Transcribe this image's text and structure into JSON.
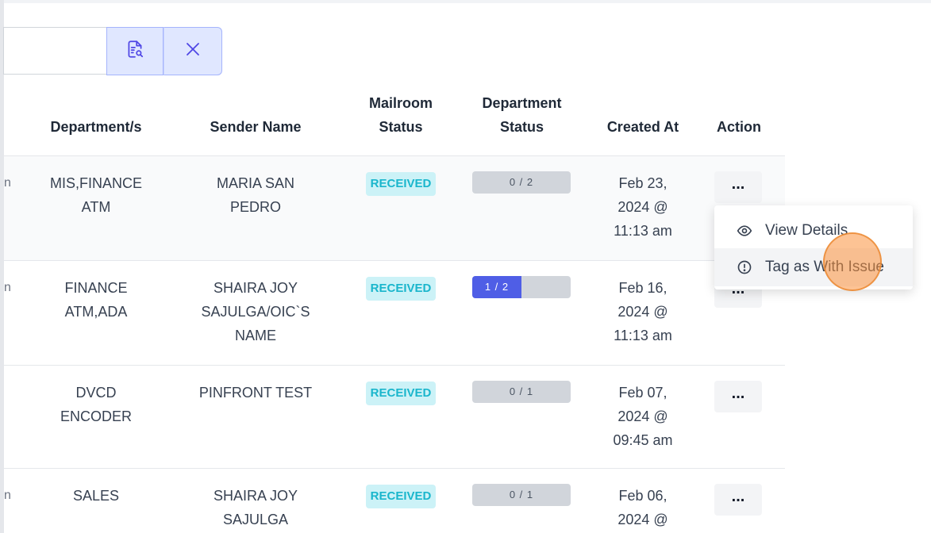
{
  "toolbar": {
    "search_placeholder": "",
    "search_icon": "document-search-icon",
    "clear_icon": "close-icon"
  },
  "table": {
    "headers": {
      "department": "Department/s",
      "sender": "Sender Name",
      "mailroom_1": "Mailroom",
      "mailroom_2": "Status",
      "dept_status_1": "Department",
      "dept_status_2": "Status",
      "created": "Created At",
      "action": "Action"
    },
    "rows": [
      {
        "edge": "n",
        "department": [
          "MIS,FINANCE",
          "ATM"
        ],
        "sender": [
          "MARIA SAN",
          "PEDRO"
        ],
        "mailroom_status": "RECEIVED",
        "dept_status": "0 / 2",
        "dept_progress": 0,
        "created": [
          "Feb 23,",
          "2024 @",
          "11:13 am"
        ],
        "action": "..."
      },
      {
        "edge": "n",
        "department": [
          "FINANCE",
          "ATM,ADA"
        ],
        "sender": [
          "SHAIRA JOY",
          "SAJULGA/OIC`S",
          "NAME"
        ],
        "mailroom_status": "RECEIVED",
        "dept_status": "1 / 2",
        "dept_progress": 0.5,
        "created": [
          "Feb 16,",
          "2024 @",
          "11:13 am"
        ],
        "action": "..."
      },
      {
        "edge": "",
        "department": [
          "DVCD",
          "ENCODER"
        ],
        "sender": [
          "PINFRONT TEST"
        ],
        "mailroom_status": "RECEIVED",
        "dept_status": "0 / 1",
        "dept_progress": 0,
        "created": [
          "Feb 07,",
          "2024 @",
          "09:45 am"
        ],
        "action": "..."
      },
      {
        "edge": "n",
        "department": [
          "SALES"
        ],
        "sender": [
          "SHAIRA JOY",
          "SAJULGA"
        ],
        "mailroom_status": "RECEIVED",
        "dept_status": "0 / 1",
        "dept_progress": 0,
        "created": [
          "Feb 06,",
          "2024 @"
        ],
        "action": "..."
      }
    ]
  },
  "action_menu": {
    "items": [
      {
        "label": "View Details",
        "icon": "eye-icon"
      },
      {
        "label": "Tag as With Issue",
        "icon": "alert-circle-icon"
      }
    ]
  },
  "colors": {
    "badge_bg": "#ccf2f7",
    "badge_text": "#1ab6cc",
    "progress_fill": "#4f5ee6",
    "button_bg": "#e0e7ff",
    "cursor": "#fb923c"
  }
}
